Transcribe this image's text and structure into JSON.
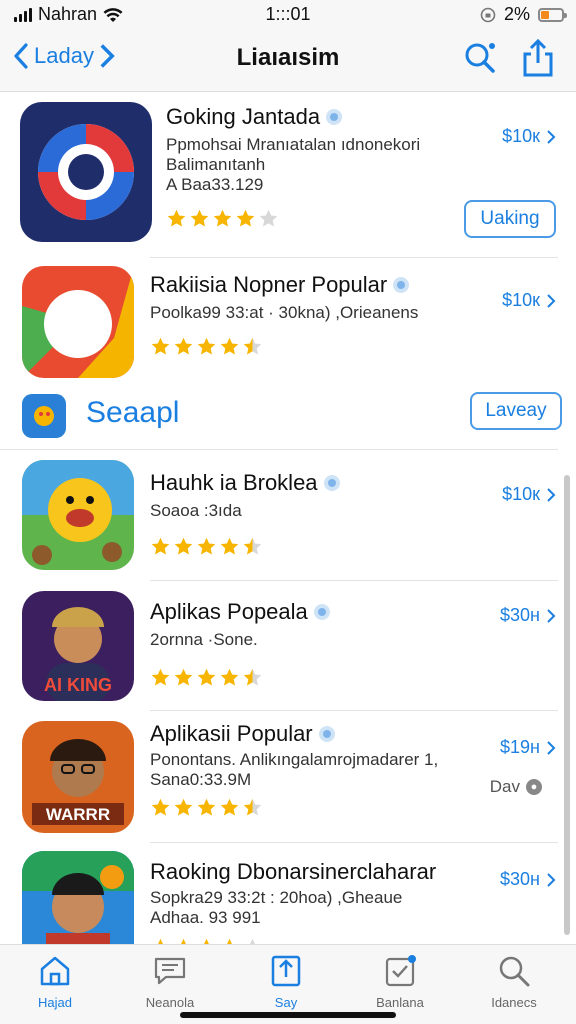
{
  "status": {
    "carrier": "Nahran",
    "time": "1:::01",
    "battery": "2%"
  },
  "nav": {
    "back_label": "Laday",
    "title": "Liaıaısim"
  },
  "apps": [
    {
      "name": "Goking Jantada",
      "sub1": "Ppmohsai Mranıatalan ıdnonekori",
      "sub2": "Balimanıtanh",
      "sub3": "A Baa33.129",
      "price": "$10к",
      "rating": 4,
      "button": "Uaking"
    },
    {
      "name": "Rakiisia Nopner Popular",
      "sub1": "Poolka99 33:at · 30kna) ,Orieanens",
      "price": "$10к",
      "rating": 4.5
    },
    {
      "name": "Hauhk ia Broklea",
      "sub1": "Soaoa :3ıda",
      "price": "$10к",
      "rating": 4.5
    },
    {
      "name": "Aplikas Popeala",
      "sub1": "2ornna ·Sone.",
      "price": "$30н",
      "rating": 4.5
    },
    {
      "name": "Aplikasii Popular",
      "sub1": "Ponontans. Anlikıngalamrojmadarer 1,",
      "sub2": "Sana0:33.9M",
      "price": "$19н",
      "rating": 4.5,
      "extra": "Dav"
    },
    {
      "name": "Raoking Dbonarsinerclaharar",
      "sub1": "Sopkra29 33:2t : 20hoa) ,Gheaue",
      "sub2": "Adhaa. 93 991",
      "price": "$30н",
      "rating": 4
    }
  ],
  "promo": {
    "text": "Seaapl",
    "button": "Laveay"
  },
  "tabs": [
    {
      "label": "Hajad",
      "icon": "home-icon"
    },
    {
      "label": "Neanola",
      "icon": "chat-icon"
    },
    {
      "label": "Say",
      "icon": "apps-icon"
    },
    {
      "label": "Banlana",
      "icon": "updates-icon"
    },
    {
      "label": "Idanecs",
      "icon": "search-icon"
    }
  ],
  "colors": {
    "accent": "#1a7fe0",
    "star": "#f7b500"
  }
}
